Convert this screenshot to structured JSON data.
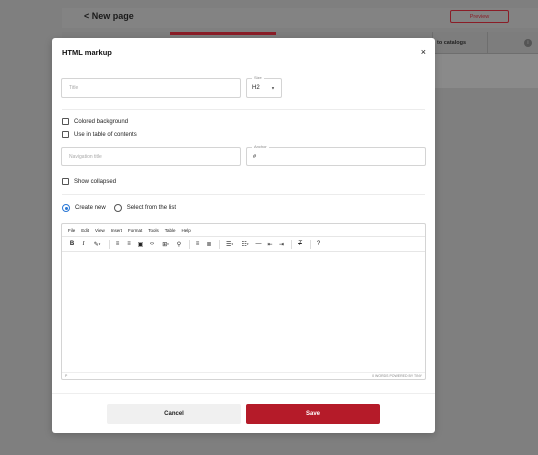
{
  "background": {
    "page_title": "New page",
    "back_glyph": "<",
    "preview_label": "Preview",
    "catalogs_tab": "to catalogs",
    "info_glyph": "i"
  },
  "modal": {
    "title": "HTML markup",
    "close_glyph": "×",
    "title_field": {
      "placeholder": "Title"
    },
    "size_field": {
      "label": "Size",
      "value": "H2"
    },
    "colored_background": "Colored background",
    "use_in_toc": "Use in table of contents",
    "navigation_title": {
      "placeholder": "Navigation title"
    },
    "anchor_field": {
      "label": "Anchor",
      "value": "#"
    },
    "show_collapsed": "Show collapsed",
    "create_new": "Create new",
    "select_from_list": "Select from the list",
    "editor": {
      "menu": [
        "File",
        "Edit",
        "View",
        "Insert",
        "Format",
        "Tools",
        "Table",
        "Help"
      ],
      "status_left": "P",
      "status_right": "0 WORDS  POWERED BY TINY"
    },
    "cancel_label": "Cancel",
    "save_label": "Save"
  },
  "colors": {
    "accent": "#b51b29",
    "radio": "#2a78d6"
  }
}
